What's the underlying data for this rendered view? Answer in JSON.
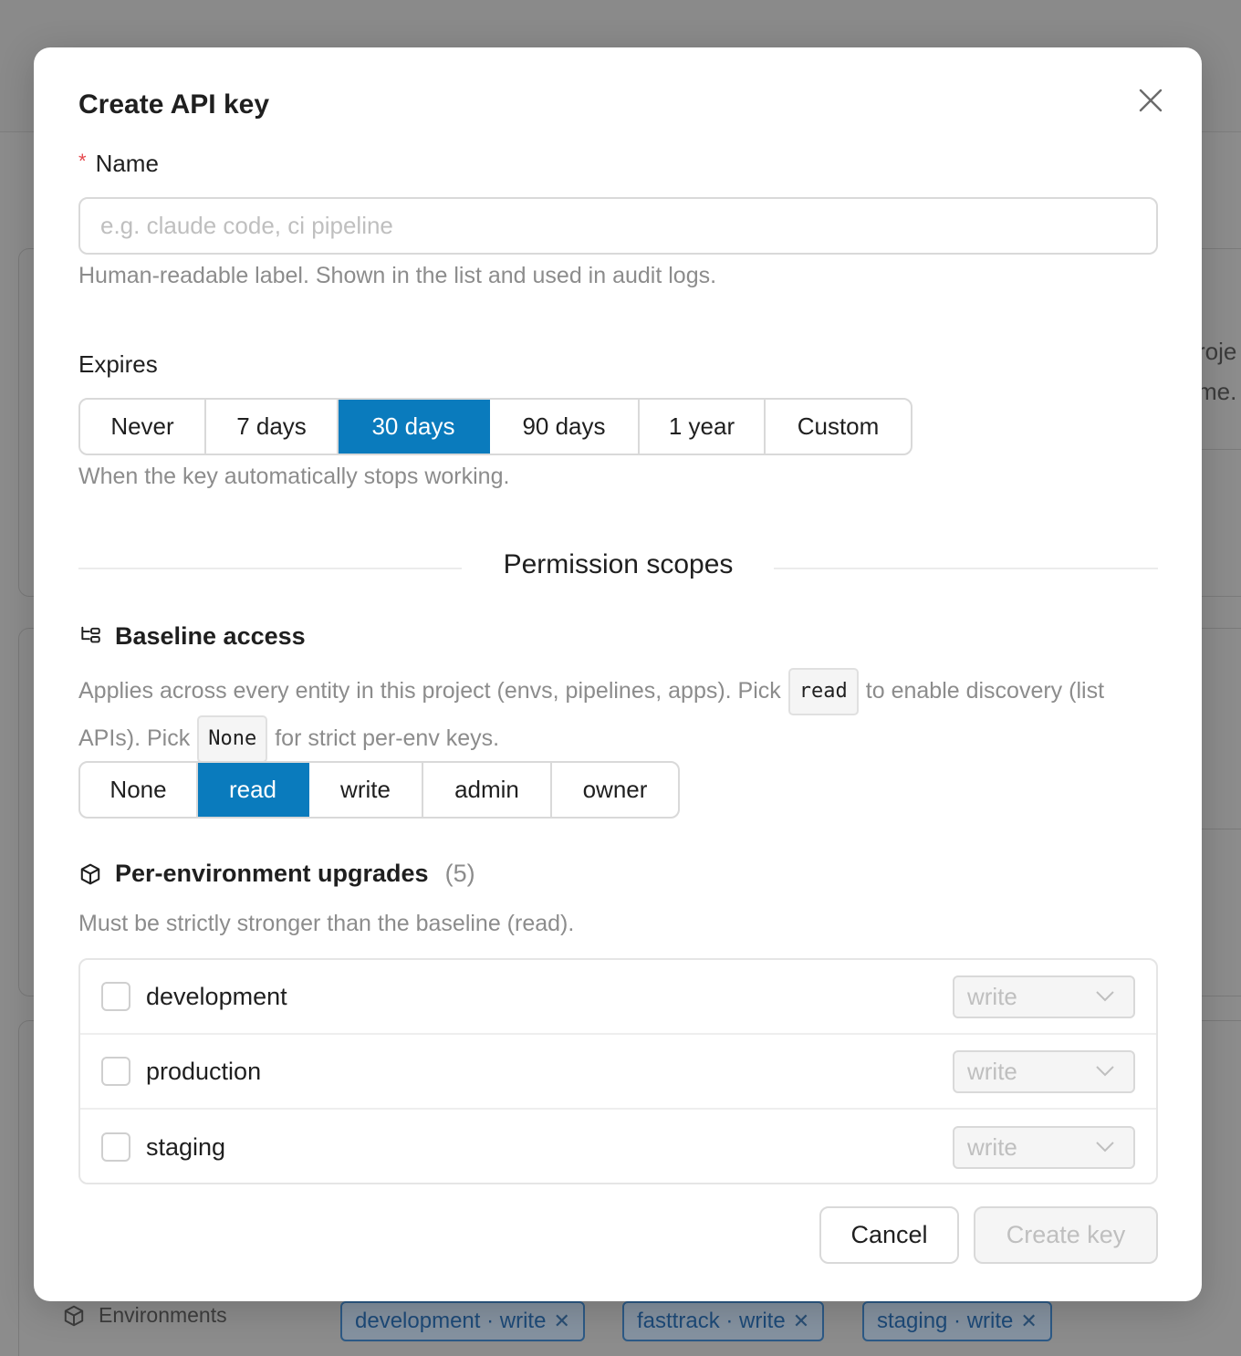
{
  "background": {
    "partial_text_1": "roje",
    "partial_text_2": "me.",
    "environments_label": "Environments",
    "tags": [
      {
        "label": "development · write",
        "remove": "✕"
      },
      {
        "label": "fasttrack · write",
        "remove": "✕"
      },
      {
        "label": "staging · write",
        "remove": "✕"
      }
    ]
  },
  "modal": {
    "title": "Create API key",
    "close_icon": "close-icon",
    "name": {
      "required_mark": "*",
      "label": "Name",
      "placeholder": "e.g. claude code, ci pipeline",
      "value": "",
      "help": "Human-readable label. Shown in the list and used in audit logs."
    },
    "expires": {
      "label": "Expires",
      "options": [
        "Never",
        "7 days",
        "30 days",
        "90 days",
        "1 year",
        "Custom"
      ],
      "selected": "30 days",
      "help": "When the key automatically stops working."
    },
    "permission_scopes": {
      "title": "Permission scopes",
      "baseline": {
        "icon": "hierarchy-icon",
        "title": "Baseline access",
        "desc_part1": "Applies across every entity in this project (envs, pipelines, apps). Pick",
        "code_read": "read",
        "desc_part2": "to enable discovery (list APIs). Pick",
        "code_none": "None",
        "desc_part3": "for strict per-env keys.",
        "options": [
          "None",
          "read",
          "write",
          "admin",
          "owner"
        ],
        "selected": "read"
      },
      "per_env": {
        "icon": "cube-icon",
        "title": "Per-environment upgrades",
        "count": "(5)",
        "help": "Must be strictly stronger than the baseline (read).",
        "rows": [
          {
            "name": "development",
            "checked": false,
            "level": "write"
          },
          {
            "name": "production",
            "checked": false,
            "level": "write"
          },
          {
            "name": "staging",
            "checked": false,
            "level": "write"
          }
        ]
      }
    },
    "buttons": {
      "cancel": "Cancel",
      "create": "Create key"
    }
  },
  "colors": {
    "accent": "#0a7bbd",
    "required": "#e5484d",
    "muted_text": "#8c8c8c",
    "overlay": "#8c8c8c"
  }
}
